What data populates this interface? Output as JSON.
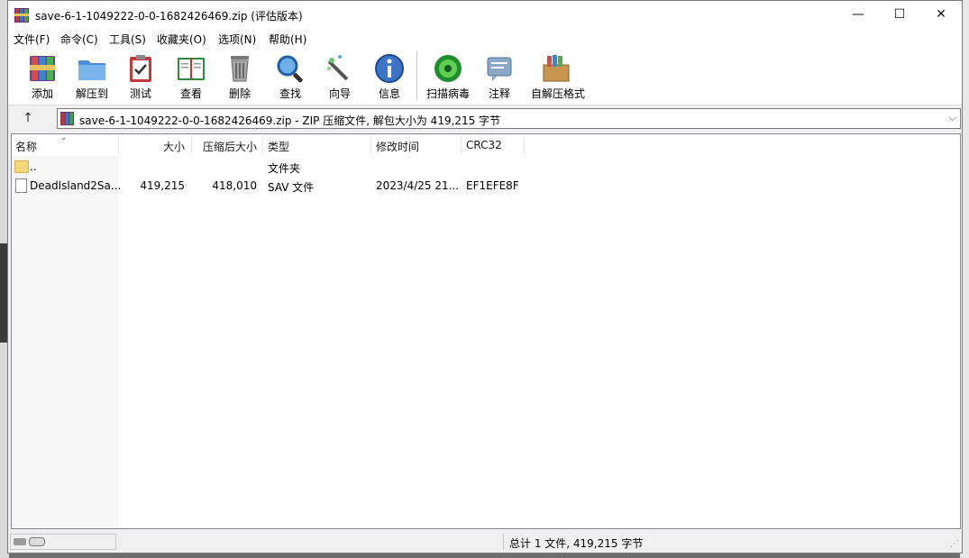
{
  "window": {
    "title": "save-6-1-1049222-0-0-1682426469.zip (评估版本)",
    "minimize": "—",
    "maximize": "☐",
    "close": "✕"
  },
  "menu": [
    "文件(F)",
    "命令(C)",
    "工具(S)",
    "收藏夹(O)",
    "选项(N)",
    "帮助(H)"
  ],
  "toolbar": {
    "add": "添加",
    "extract": "解压到",
    "test": "测试",
    "view": "查看",
    "delete": "删除",
    "find": "查找",
    "wizard": "向导",
    "info": "信息",
    "virus_scan": "扫描病毒",
    "comment": "注释",
    "sfx": "自解压格式"
  },
  "address": {
    "up": "↑",
    "text": "save-6-1-1049222-0-0-1682426469.zip - ZIP 压缩文件, 解包大小为 419,215 字节",
    "dropdown": "⌵"
  },
  "columns": {
    "name": "名称",
    "size": "大小",
    "packed": "压缩后大小",
    "type": "类型",
    "modified": "修改时间",
    "crc": "CRC32"
  },
  "rows": [
    {
      "name": "..",
      "size": "",
      "packed": "",
      "type": "文件夹",
      "modified": "",
      "crc": ""
    },
    {
      "name": "DeadIsland2Sa...",
      "size": "419,215",
      "packed": "418,010",
      "type": "SAV 文件",
      "modified": "2023/4/25 21...",
      "crc": "EF1EFE8F"
    }
  ],
  "status": {
    "summary": "总计 1 文件, 419,215 字节"
  },
  "colors": {
    "window_bg": "#f0f0f0",
    "list_bg": "#ffffff",
    "border": "#828790"
  }
}
